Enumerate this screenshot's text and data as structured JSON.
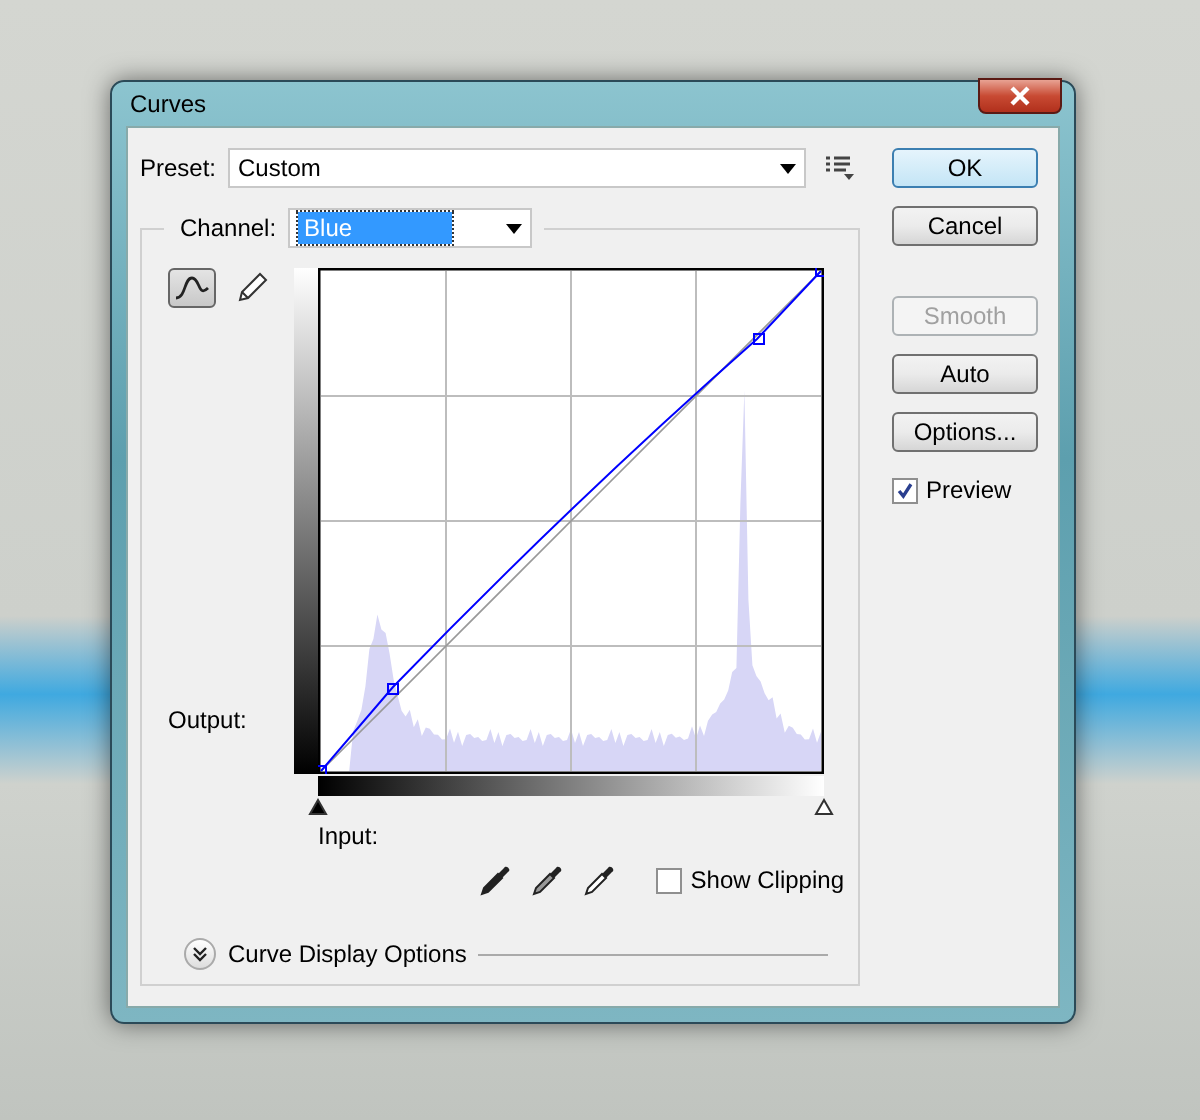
{
  "window": {
    "title": "Curves"
  },
  "preset": {
    "label": "Preset:",
    "value": "Custom"
  },
  "channel": {
    "label": "Channel:",
    "value": "Blue"
  },
  "tools": [
    {
      "kind": "curve",
      "selected": true
    },
    {
      "kind": "pencil",
      "selected": false
    }
  ],
  "graph": {
    "output_label": "Output:",
    "input_label": "Input:"
  },
  "input_sliders": [
    {
      "level": 0
    },
    {
      "level": 1
    }
  ],
  "show_clipping": {
    "label": "Show Clipping",
    "checked": false
  },
  "display_options": {
    "label": "Curve Display Options",
    "expanded": false
  },
  "buttons": [
    {
      "label": "OK",
      "default": true,
      "disabled": false
    },
    {
      "label": "Cancel",
      "default": false,
      "disabled": false
    }
  ],
  "curve_buttons": [
    {
      "label": "Smooth",
      "disabled": true
    },
    {
      "label": "Auto",
      "disabled": false
    },
    {
      "label": "Options...",
      "disabled": false
    }
  ],
  "preview": {
    "label": "Preview",
    "checked": true
  }
}
